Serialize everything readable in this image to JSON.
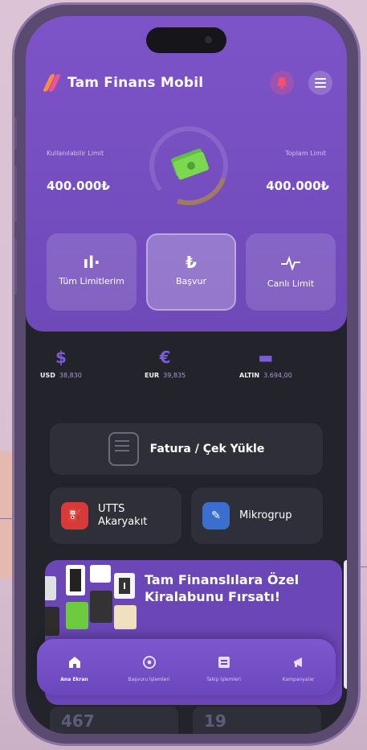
{
  "app": {
    "title": "Tam Finans Mobil"
  },
  "limits": {
    "left_label": "Kullanılabilir Limit",
    "left_value": "400.000₺",
    "right_label": "Toplam Limit",
    "right_value": "400.000₺"
  },
  "cards": [
    {
      "label": "Tüm Limitlerim",
      "icon": "chart-icon"
    },
    {
      "label": "Başvur",
      "icon": "lira-icon"
    },
    {
      "label": "Canlı Limit",
      "icon": "pulse-icon"
    }
  ],
  "rates": [
    {
      "symbol": "$",
      "code": "USD",
      "value": "38,830"
    },
    {
      "symbol": "€",
      "code": "EUR",
      "value": "39,835"
    },
    {
      "symbol": "▬",
      "code": "ALTIN",
      "value": "3.694,00"
    }
  ],
  "upload": {
    "label": "Fatura / Çek Yükle"
  },
  "partners": [
    {
      "label_line1": "UTTS",
      "label_line2": "Akaryakıt",
      "color": "#d83a3a"
    },
    {
      "label": "Mikrogrup",
      "color": "#3a6fd0"
    }
  ],
  "banner": {
    "title": "Tam Finanslılara Özel Kiralabunu Fırsatı!"
  },
  "stats": {
    "left": "467",
    "right": "19"
  },
  "nav": [
    {
      "label": "Ana Ekran",
      "icon": "home-icon"
    },
    {
      "label": "Başvuru İşlemleri",
      "icon": "settings-icon"
    },
    {
      "label": "Takip İşlemleri",
      "icon": "document-icon"
    },
    {
      "label": "Kampanyalar",
      "icon": "megaphone-icon"
    }
  ],
  "colors": {
    "accent": "#7d54c8",
    "dark_bg": "#23232b",
    "card_bg": "#2f2f39"
  }
}
